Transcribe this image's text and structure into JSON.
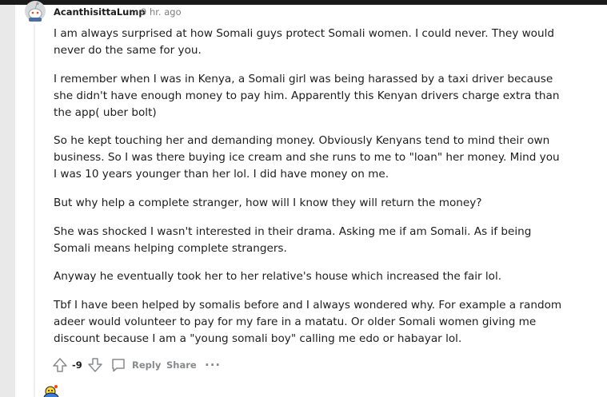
{
  "comment": {
    "username": "AcanthisittaLump",
    "separator": "·",
    "time": "9 hr. ago",
    "paragraphs": [
      "I am always surprised at how Somali guys protect Somali women. I could never. They would never do the same for you.",
      "I remember when I was in Kenya, a Somali girl was being harassed by a taxi driver because she didn't have enough money to pay him. Apparently this Kenyan drivers charge extra than the app( uber bolt)",
      "So he kept touching her and demanding money. Obviously Kenyans tend to mind their own business. So I was there buying ice cream and she runs to me to \"loan\" her money. Mind you I was 10 years younger than her lol. I did have money on me.",
      "But why help a complete stranger, how will I know they will return the money?",
      "She was shocked I wasn't interested in their drama. Asking me if am Somali. As if being Somali means helping complete strangers.",
      "Anyway he eventually took her to her relative's house which increased the fair lol.",
      "Tbf I have been helped by somalis before and I always wondered why. For example a random adeer would volunteer to pay for my fare in a matatu. Or older Somali women giving me discount because I am a \"young somali boy\" calling me edo or habayar lol."
    ],
    "score": "-9",
    "actions": {
      "reply": "Reply",
      "share": "Share",
      "more": "···"
    }
  },
  "icons": {
    "avatar": "snoo-avatar-icon",
    "upvote": "upvote-arrow-icon",
    "downvote": "downvote-arrow-icon",
    "reply": "comment-bubble-icon",
    "more": "more-options-icon"
  },
  "colors": {
    "text": "#1c1c1c",
    "muted": "#7c7c7c",
    "icon": "#878a8c"
  }
}
